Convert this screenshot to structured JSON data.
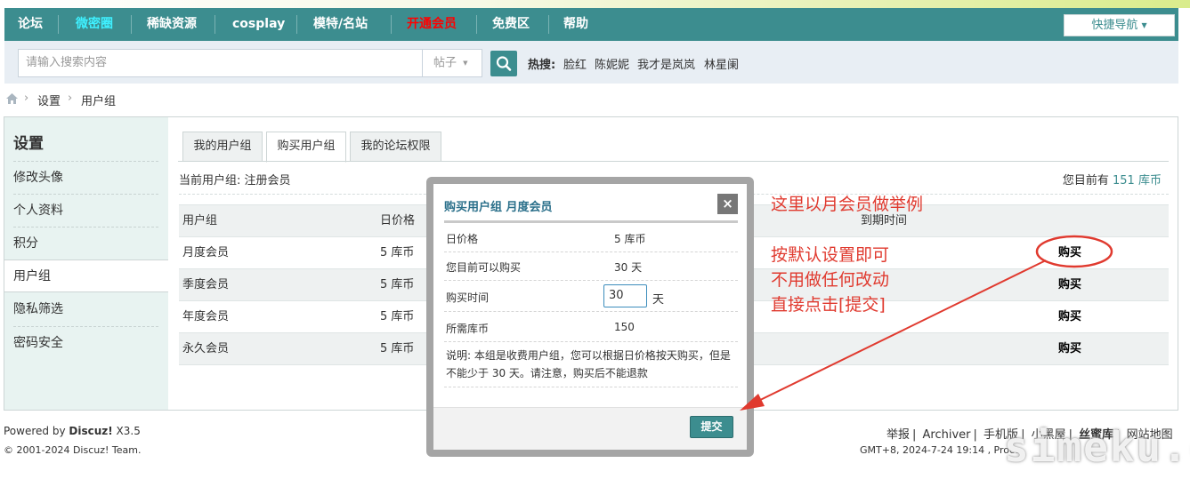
{
  "nav": {
    "items": [
      "论坛",
      "微密圈",
      "稀缺资源",
      "cosplay",
      "模特/名站",
      "开通会员",
      "免费区",
      "帮助"
    ],
    "quick_nav": "快捷导航"
  },
  "search": {
    "placeholder": "请输入搜索内容",
    "type": "帖子",
    "hot_label": "热搜:",
    "hot": [
      "脸红",
      "陈妮妮",
      "我才是岚岚",
      "林星阑"
    ]
  },
  "breadcrumb": [
    "设置",
    "用户组"
  ],
  "sidebar": {
    "title": "设置",
    "items": [
      "修改头像",
      "个人资料",
      "积分",
      "用户组",
      "隐私筛选",
      "密码安全"
    ],
    "active": "用户组"
  },
  "tabs": [
    "我的用户组",
    "购买用户组",
    "我的论坛权限"
  ],
  "active_tab": "购买用户组",
  "current_group": "当前用户组: 注册会员",
  "balance": {
    "prefix": "您目前有",
    "amount": "151",
    "unit": "库币"
  },
  "table": {
    "headers": [
      "用户组",
      "日价格",
      "到期时间"
    ],
    "rows": [
      {
        "name": "月度会员",
        "price": "5 库币",
        "action": "购买"
      },
      {
        "name": "季度会员",
        "price": "5 库币",
        "action": "购买"
      },
      {
        "name": "年度会员",
        "price": "5 库币",
        "action": "购买"
      },
      {
        "name": "永久会员",
        "price": "5 库币",
        "action": "购买"
      }
    ]
  },
  "modal": {
    "title": "购买用户组 月度会员",
    "close": "×",
    "rows": [
      {
        "label": "日价格",
        "value": "5 库币"
      },
      {
        "label": "您目前可以购买",
        "value": "30 天"
      },
      {
        "label": "购买时间",
        "value": ""
      },
      {
        "label": "所需库币",
        "value": "150"
      }
    ],
    "days_value": "30",
    "days_unit": "天",
    "note": "说明: 本组是收费用户组，您可以根据日价格按天购买，但是不能少于 30 天。请注意，购买后不能退款",
    "submit": "提交"
  },
  "annotations": [
    "这里以月会员做举例",
    "按默认设置即可",
    "不用做任何改动",
    "直接点击[提交]"
  ],
  "footer": {
    "powered_prefix": "Powered by ",
    "powered_brand": "Discuz!",
    "powered_version": " X3.5",
    "copyright": "© 2001-2024 Discuz! Team.",
    "links": [
      "举报",
      "Archiver",
      "手机版",
      "小黑屋",
      "丝蜜库",
      "网站地图"
    ],
    "gmt": "GMT+8, 2024-7-24 19:14 , Proce",
    "watermark": "simeku.cn"
  },
  "colors": {
    "brand": "#3c8d8f",
    "annotation": "#e03a2f",
    "hot_nav": "#ff0000",
    "accent_nav": "#3ff0ff"
  }
}
